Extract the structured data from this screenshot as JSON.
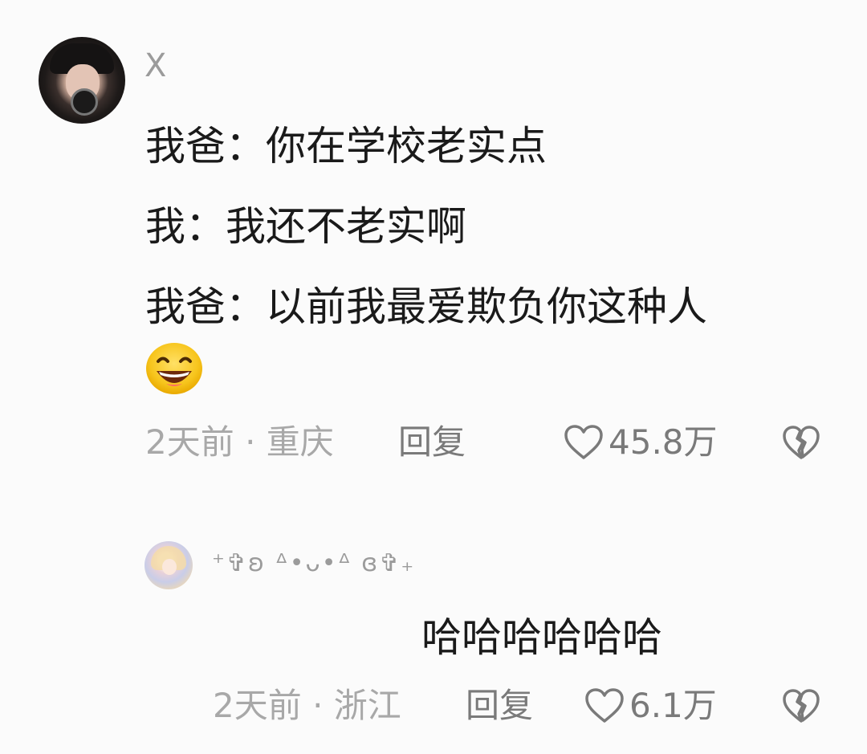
{
  "comment": {
    "username": "X",
    "avatar_icon": "user-avatar",
    "lines": [
      "我爸：你在学校老实点",
      "我：我还不老实啊",
      "我爸：以前我最爱欺负你这种人"
    ],
    "emoji_icon": "grinning-face-emoji",
    "meta": "2天前 · 重庆",
    "reply_label": "回复",
    "like_icon": "heart-outline-icon",
    "like_count": "45.8万",
    "dislike_icon": "broken-heart-icon"
  },
  "reply": {
    "username": "⁺✞ʚ ᐞ•ᴗ•ᐞ ɞ✞₊",
    "avatar_icon": "user-avatar",
    "text": "哈哈哈哈哈哈",
    "meta": "2天前 · 浙江",
    "reply_label": "回复",
    "like_icon": "heart-outline-icon",
    "like_count": "6.1万",
    "dislike_icon": "broken-heart-icon"
  },
  "colors": {
    "background": "#fbfbfb",
    "text_primary": "#1a1a1a",
    "text_meta": "#a8a8a8",
    "text_action": "#7a7a7a"
  }
}
